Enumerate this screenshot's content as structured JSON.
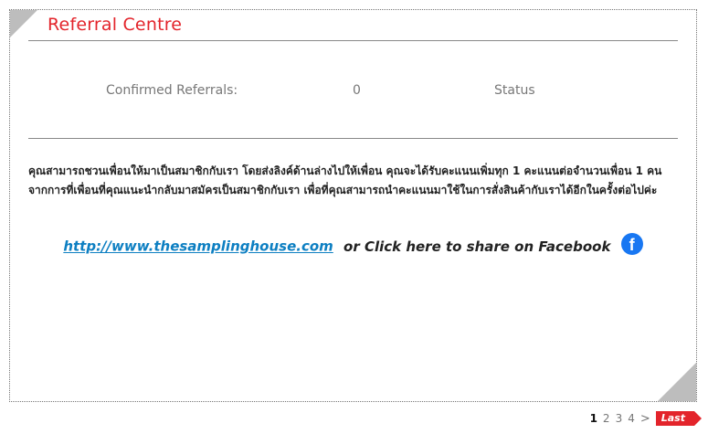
{
  "referral": {
    "title": "Referral Centre",
    "confirmed_label": "Confirmed Referrals:",
    "confirmed_value": "0",
    "status_label": "Status",
    "description": "คุณสามารถชวนเพื่อนให้มาเป็นสมาชิกกับเรา โดยส่งลิงค์ด้านล่างไปให้เพื่อน คุณจะได้รับคะแนนเพิ่มทุก 1 คะแนนต่อจำนวนเพื่อน 1 คนจากการที่เพื่อนที่คุณแนะนำกลับมาสมัครเป็นสมาชิกกับเรา เพื่อที่คุณสามารถนำคะแนนมาใช้ในการสั่งสินค้ากับเราได้อีกในครั้งต่อไปค่ะ",
    "link_text": "http://www.thesamplinghouse.com",
    "share_text": "or Click here to share on Facebook",
    "facebook_glyph": "f"
  },
  "pagination": {
    "current": "1",
    "pages": [
      "2",
      "3",
      "4"
    ],
    "next": ">",
    "last_label": "Last"
  },
  "colors": {
    "accent": "#e3242b",
    "link": "#0d7fc2",
    "facebook": "#1877f2"
  },
  "icons": {
    "facebook": "facebook-icon",
    "next": "chevron-right-icon"
  }
}
